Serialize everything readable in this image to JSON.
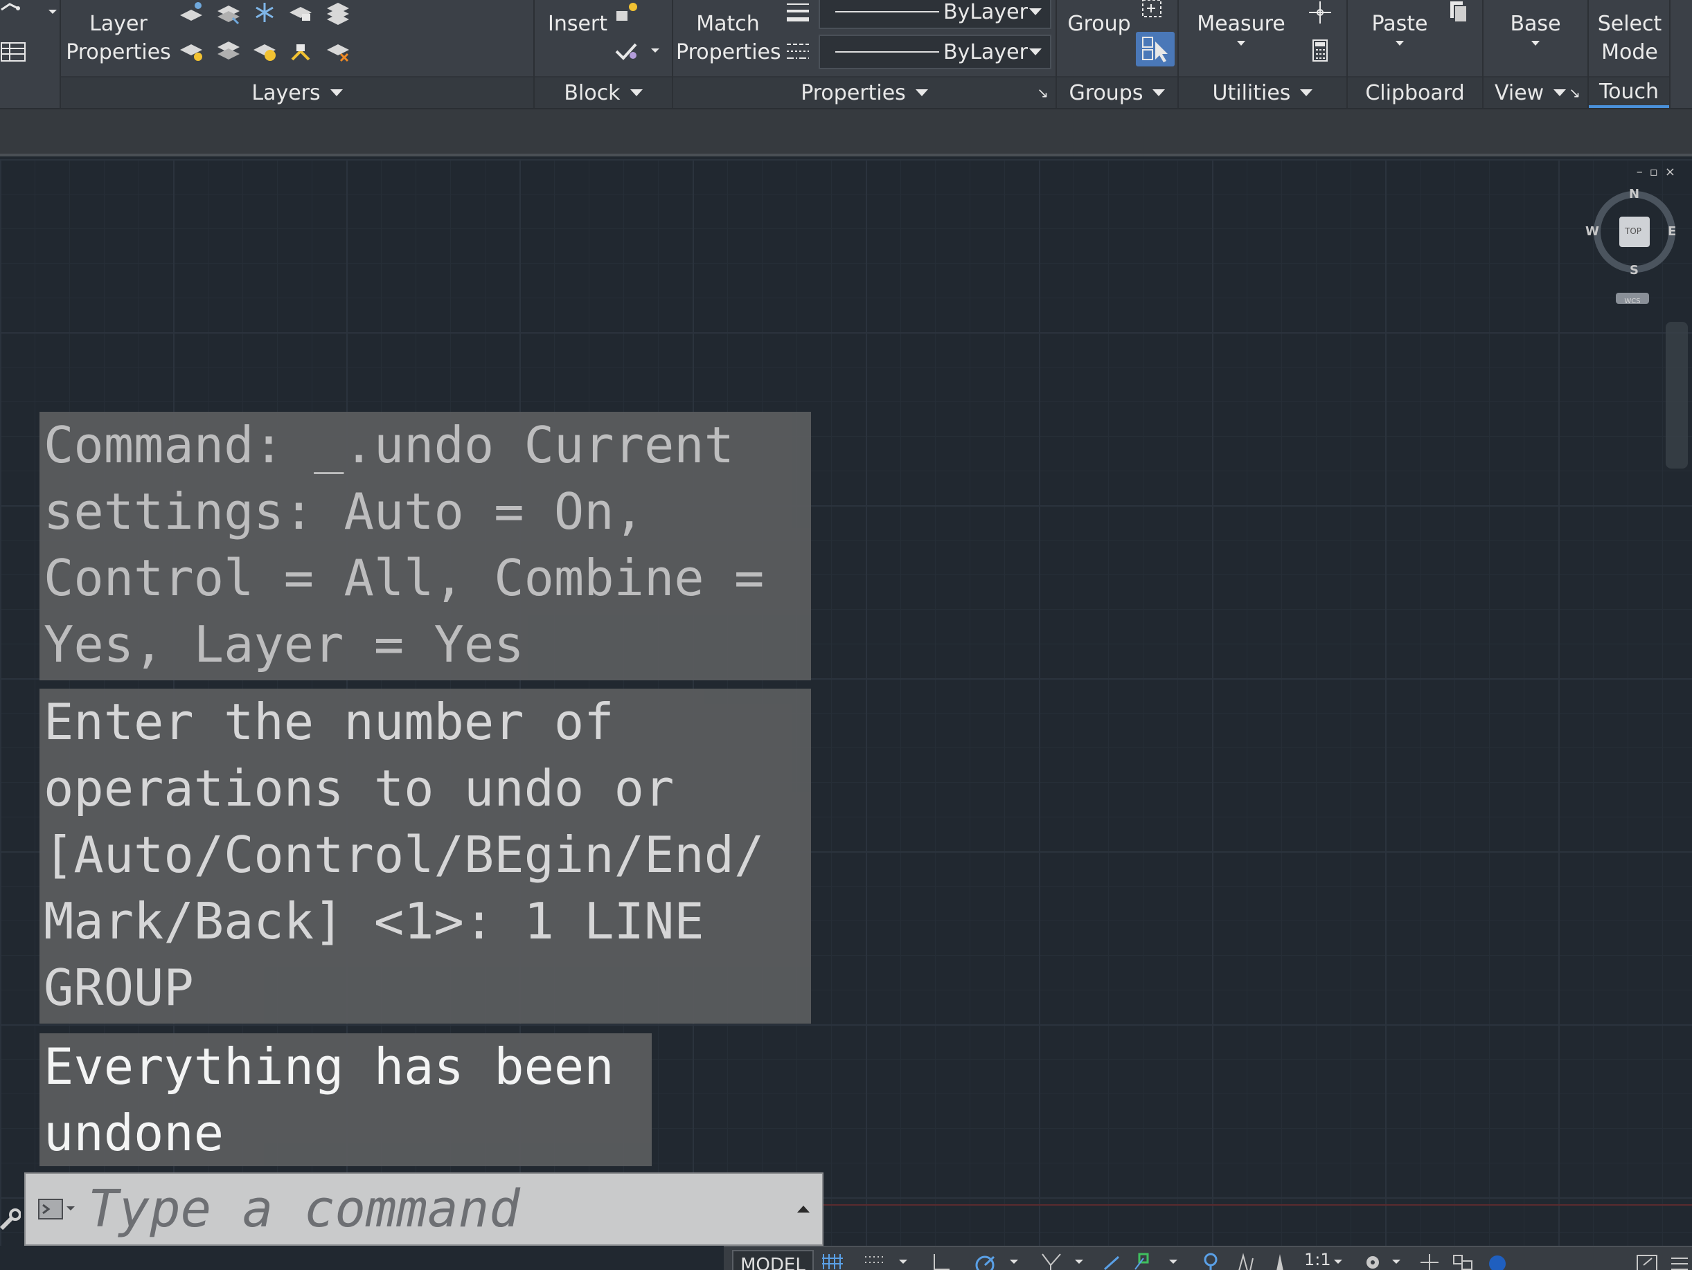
{
  "ribbon": {
    "layers": {
      "button_label_1": "Layer",
      "button_label_2": "Properties",
      "footer": "Layers"
    },
    "block": {
      "insert_label": "Insert",
      "footer": "Block"
    },
    "properties": {
      "match_label_1": "Match",
      "match_label_2": "Properties",
      "color_value": "ByLayer",
      "linetype_value": "ByLayer",
      "footer": "Properties"
    },
    "groups": {
      "group_label": "Group",
      "footer": "Groups"
    },
    "utilities": {
      "measure_label": "Measure",
      "footer": "Utilities"
    },
    "clipboard": {
      "paste_label": "Paste",
      "footer": "Clipboard"
    },
    "view": {
      "base_label": "Base",
      "footer": "View"
    },
    "touch": {
      "select_label_1": "Select",
      "select_label_2": "Mode",
      "footer": "Touch"
    }
  },
  "viewcube": {
    "north": "N",
    "south": "S",
    "east": "E",
    "west": "W",
    "face": "TOP",
    "ucs": "WCS"
  },
  "command_history": [
    "Command: _.undo Current settings: Auto = On, Control = All, Combine = Yes, Layer = Yes",
    "Enter the number of operations to undo or [Auto/Control/BEgin/End/ Mark/Back] <1>: 1 LINE GROUP",
    "Everything has been undone"
  ],
  "command_line": {
    "placeholder": "Type a command"
  },
  "statusbar": {
    "model_tab": "MODEL",
    "scale": "1:1"
  },
  "colors": {
    "canvas_bg": "#212830",
    "ribbon_bg": "#3b4047",
    "history_bg": "#5a5c5e",
    "cmdline_bg": "#c9cacb"
  }
}
